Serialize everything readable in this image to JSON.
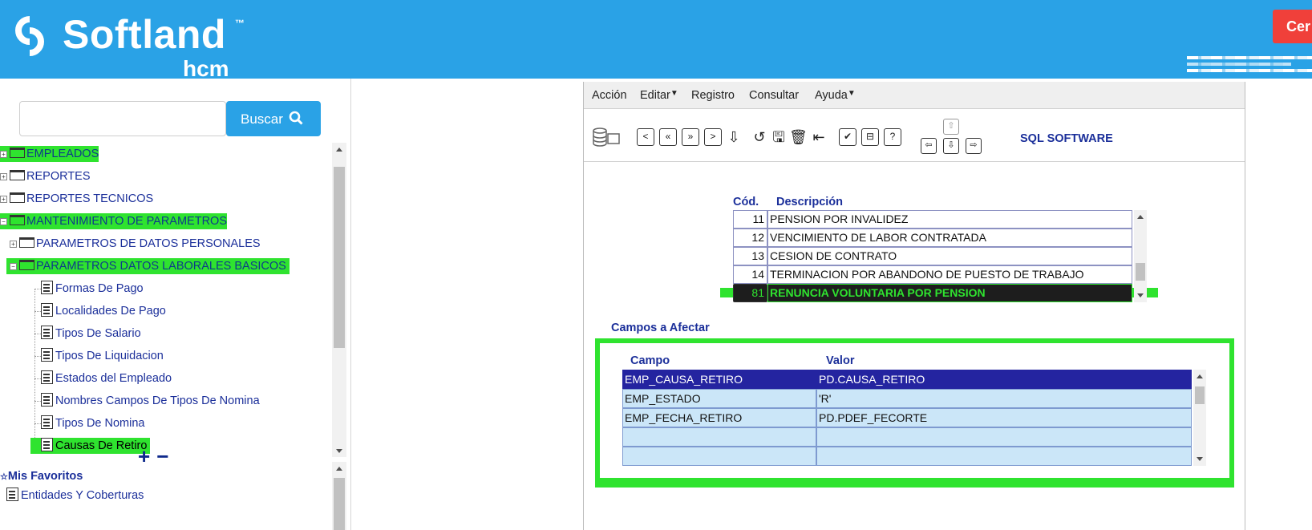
{
  "header": {
    "brand": "Softland",
    "brand_tm": "™",
    "brand_sub": "hcm",
    "logout_label": "Cer"
  },
  "search": {
    "placeholder": "",
    "button_label": "Buscar"
  },
  "tree": [
    {
      "label": "EMPLEADOS"
    },
    {
      "label": "REPORTES"
    },
    {
      "label": "REPORTES TECNICOS"
    },
    {
      "label": "MANTENIMIENTO DE PARAMETROS"
    },
    {
      "label": "PARAMETROS DE DATOS PERSONALES"
    },
    {
      "label": "PARAMETROS DATOS LABORALES BASICOS"
    },
    {
      "label": "Formas De Pago"
    },
    {
      "label": "Localidades De Pago"
    },
    {
      "label": "Tipos De Salario"
    },
    {
      "label": "Tipos De Liquidacion"
    },
    {
      "label": "Estados del Empleado"
    },
    {
      "label": "Nombres Campos De Tipos De Nomina"
    },
    {
      "label": "Tipos De Nomina"
    },
    {
      "label": "Causas De Retiro"
    }
  ],
  "tree_controls": {
    "add": "+",
    "remove": "−"
  },
  "favorites": {
    "title": "Mis Favoritos",
    "items": [
      "Entidades Y Coberturas"
    ]
  },
  "form": {
    "menu": [
      "Acción",
      "Editar",
      "Registro",
      "Consultar",
      "Ayuda"
    ],
    "toolbar_label": "SQL SOFTWARE",
    "causes": {
      "headers": [
        "Cód.",
        "Descripción"
      ],
      "rows": [
        {
          "code": "11",
          "description": "PENSION POR INVALIDEZ"
        },
        {
          "code": "12",
          "description": "VENCIMIENTO DE LABOR CONTRATADA"
        },
        {
          "code": "13",
          "description": "CESION DE CONTRATO"
        },
        {
          "code": "14",
          "description": "TERMINACION POR ABANDONO DE PUESTO DE TRABAJO"
        },
        {
          "code": "81",
          "description": "RENUNCIA VOLUNTARIA POR PENSION"
        }
      ]
    },
    "fields": {
      "title": "Campos a Afectar",
      "headers": [
        "Campo",
        "Valor"
      ],
      "rows": [
        {
          "campo": "EMP_CAUSA_RETIRO",
          "valor": "PD.CAUSA_RETIRO"
        },
        {
          "campo": "EMP_ESTADO",
          "valor": "'R'"
        },
        {
          "campo": "EMP_FECHA_RETIRO",
          "valor": "PD.PDEF_FECORTE"
        },
        {
          "campo": "",
          "valor": ""
        },
        {
          "campo": "",
          "valor": ""
        }
      ]
    }
  },
  "colors": {
    "header_blue": "#2aa2e6",
    "highlight_green": "#2fe32f",
    "selected_row_navy": "#2424a0",
    "logout_red": "#f0403a"
  }
}
